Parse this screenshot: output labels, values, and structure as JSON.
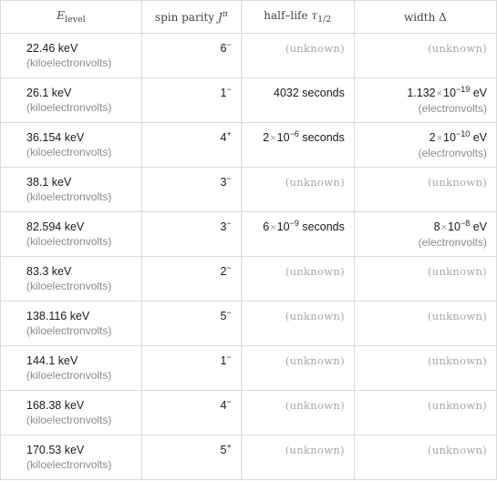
{
  "header": {
    "col1": {
      "symbol": "E",
      "subscript": "level"
    },
    "col2": {
      "label": "spin parity ",
      "symbol": "J",
      "superscript": "π"
    },
    "col3": {
      "label": "half–life ",
      "symbol": "τ",
      "subscript": "1/2"
    },
    "col4": {
      "label": "width ",
      "symbol": "Δ"
    }
  },
  "unknown_text": "(unknown)",
  "rows": [
    {
      "energy": "22.46 keV",
      "energy_unit": "(kiloelectronvolts)",
      "spin": "6",
      "parity": "−",
      "half_life": null,
      "width": null
    },
    {
      "energy": "26.1 keV",
      "energy_unit": "(kiloelectronvolts)",
      "spin": "1",
      "parity": "−",
      "half_life": {
        "mantissa": "",
        "exponent": "",
        "text": "4032 seconds"
      },
      "width": {
        "mantissa": "1.132",
        "exponent": "−19",
        "unit": "eV",
        "unit_name": "(electronvolts)"
      }
    },
    {
      "energy": "36.154 keV",
      "energy_unit": "(kiloelectronvolts)",
      "spin": "4",
      "parity": "+",
      "half_life": {
        "mantissa": "2",
        "exponent": "−6",
        "unit": "seconds"
      },
      "width": {
        "mantissa": "2",
        "exponent": "−10",
        "unit": "eV",
        "unit_name": "(electronvolts)"
      }
    },
    {
      "energy": "38.1 keV",
      "energy_unit": "(kiloelectronvolts)",
      "spin": "3",
      "parity": "−",
      "half_life": null,
      "width": null
    },
    {
      "energy": "82.594 keV",
      "energy_unit": "(kiloelectronvolts)",
      "spin": "3",
      "parity": "−",
      "half_life": {
        "mantissa": "6",
        "exponent": "−9",
        "unit": "seconds"
      },
      "width": {
        "mantissa": "8",
        "exponent": "−8",
        "unit": "eV",
        "unit_name": "(electronvolts)"
      }
    },
    {
      "energy": "83.3 keV",
      "energy_unit": "(kiloelectronvolts)",
      "spin": "2",
      "parity": "−",
      "half_life": null,
      "width": null
    },
    {
      "energy": "138.116 keV",
      "energy_unit": "(kiloelectronvolts)",
      "spin": "5",
      "parity": "−",
      "half_life": null,
      "width": null
    },
    {
      "energy": "144.1 keV",
      "energy_unit": "(kiloelectronvolts)",
      "spin": "1",
      "parity": "−",
      "half_life": null,
      "width": null
    },
    {
      "energy": "168.38 keV",
      "energy_unit": "(kiloelectronvolts)",
      "spin": "4",
      "parity": "−",
      "half_life": null,
      "width": null
    },
    {
      "energy": "170.53 keV",
      "energy_unit": "(kiloelectronvolts)",
      "spin": "5",
      "parity": "+",
      "half_life": null,
      "width": null
    }
  ]
}
